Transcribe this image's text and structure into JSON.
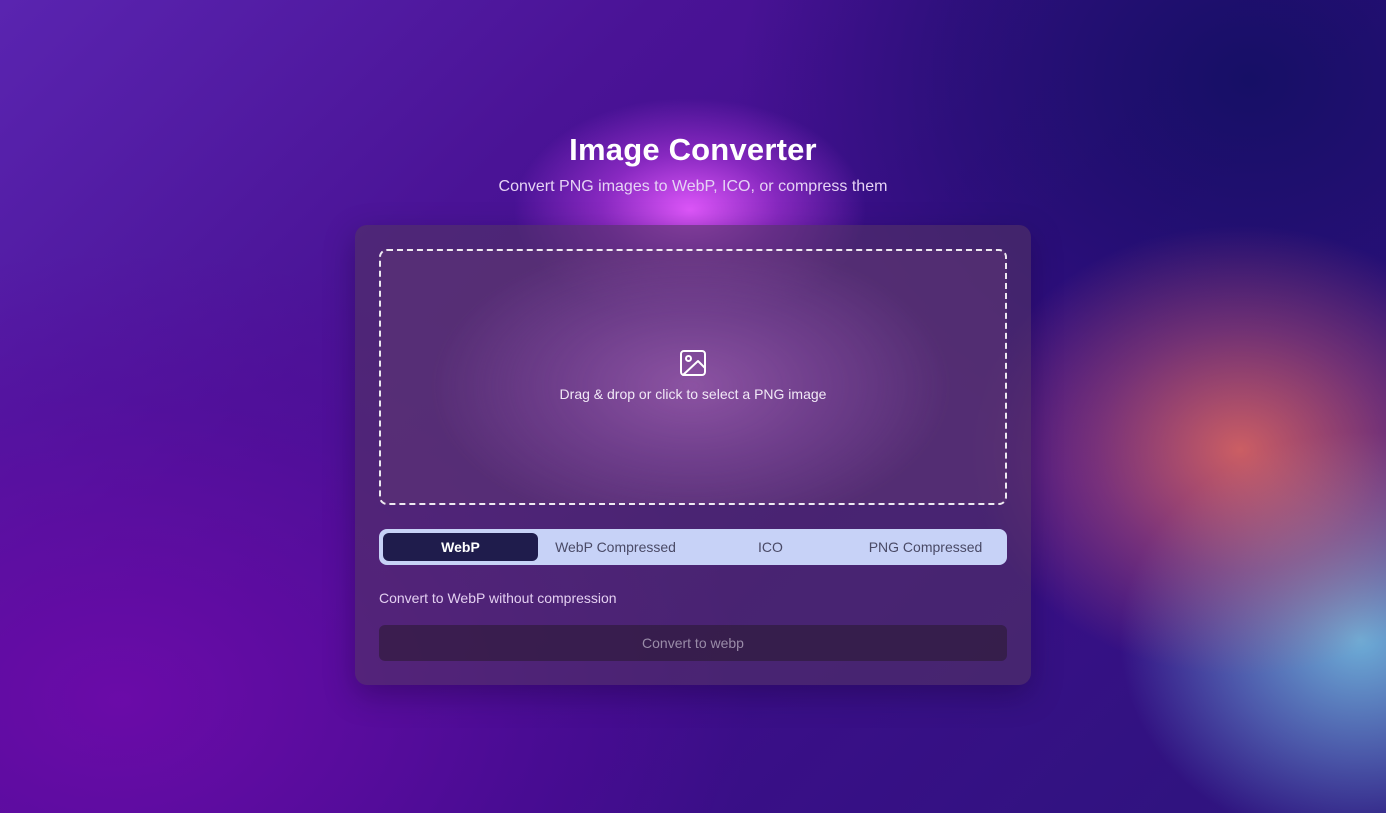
{
  "header": {
    "title": "Image Converter",
    "subtitle": "Convert PNG images to WebP, ICO, or compress them"
  },
  "dropzone": {
    "icon": "image-icon",
    "text": "Drag & drop or click to select a PNG image"
  },
  "tabs": [
    {
      "label": "WebP",
      "active": true
    },
    {
      "label": "WebP Compressed",
      "active": false
    },
    {
      "label": "ICO",
      "active": false
    },
    {
      "label": "PNG Compressed",
      "active": false
    }
  ],
  "description": "Convert to WebP without compression",
  "convert_button": {
    "label": "Convert to webp",
    "disabled": true
  },
  "colors": {
    "active_tab": "#1f1c4c",
    "tab_bar": "#c7d2f7",
    "title": "#ffffff"
  }
}
